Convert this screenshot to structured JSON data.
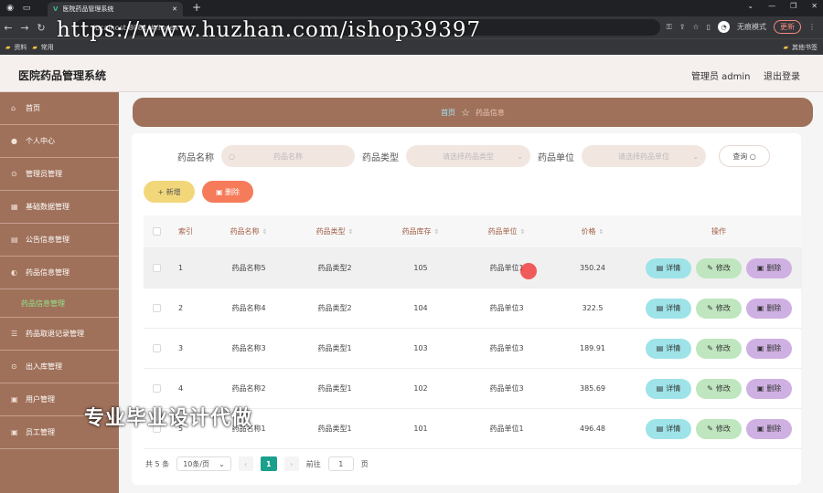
{
  "browser": {
    "tab_title": "医院药品管理系统",
    "url": "localhost:8081/#/index",
    "incognito_label": "无痕模式",
    "update_label": "更新",
    "bookmarks": [
      "资料",
      "常用"
    ],
    "other_bookmarks": "其他书签"
  },
  "watermark_top": "https://www.huzhan.com/ishop39397",
  "watermark_bottom": "专业毕业设计代做",
  "header": {
    "title": "医院药品管理系统",
    "user": "管理员 admin",
    "logout": "退出登录"
  },
  "sidebar": {
    "items": [
      {
        "label": "首页",
        "icon": "home-icon"
      },
      {
        "label": "个人中心",
        "icon": "user-icon"
      },
      {
        "label": "管理员管理",
        "icon": "pin-icon"
      },
      {
        "label": "基础数据管理",
        "icon": "grid-icon"
      },
      {
        "label": "公告信息管理",
        "icon": "doc-icon"
      },
      {
        "label": "药品信息管理",
        "icon": "pill-icon"
      },
      {
        "label": "药品取退记录管理",
        "icon": "list-icon"
      },
      {
        "label": "出入库管理",
        "icon": "pin-icon"
      },
      {
        "label": "用户管理",
        "icon": "users-icon"
      },
      {
        "label": "员工管理",
        "icon": "user-icon"
      }
    ],
    "active_sub": "药品信息管理"
  },
  "breadcrumb": {
    "home": "首页",
    "current": "药品信息"
  },
  "search": {
    "name_label": "药品名称",
    "name_placeholder": "药品名称",
    "type_label": "药品类型",
    "type_placeholder": "请选择药品类型",
    "unit_label": "药品单位",
    "unit_placeholder": "请选择药品单位",
    "query_label": "查询"
  },
  "toolbar": {
    "add_label": "新增",
    "delete_label": "删除"
  },
  "table": {
    "headers": [
      "索引",
      "药品名称",
      "药品类型",
      "药品库存",
      "药品单位",
      "价格",
      "操作"
    ],
    "rows": [
      {
        "index": "1",
        "name": "药品名称5",
        "type": "药品类型2",
        "stock": "105",
        "unit": "药品单位1",
        "price": "350.24"
      },
      {
        "index": "2",
        "name": "药品名称4",
        "type": "药品类型2",
        "stock": "104",
        "unit": "药品单位3",
        "price": "322.5"
      },
      {
        "index": "3",
        "name": "药品名称3",
        "type": "药品类型1",
        "stock": "103",
        "unit": "药品单位3",
        "price": "189.91"
      },
      {
        "index": "4",
        "name": "药品名称2",
        "type": "药品类型1",
        "stock": "102",
        "unit": "药品单位3",
        "price": "385.69"
      },
      {
        "index": "5",
        "name": "药品名称1",
        "type": "药品类型1",
        "stock": "101",
        "unit": "药品单位1",
        "price": "496.48"
      }
    ],
    "actions": {
      "detail": "详情",
      "edit": "修改",
      "delete": "删除"
    }
  },
  "pagination": {
    "total": "共 5 条",
    "page_size": "10条/页",
    "current_page": "1",
    "goto_label": "前往",
    "goto_value": "1",
    "page_unit": "页"
  }
}
